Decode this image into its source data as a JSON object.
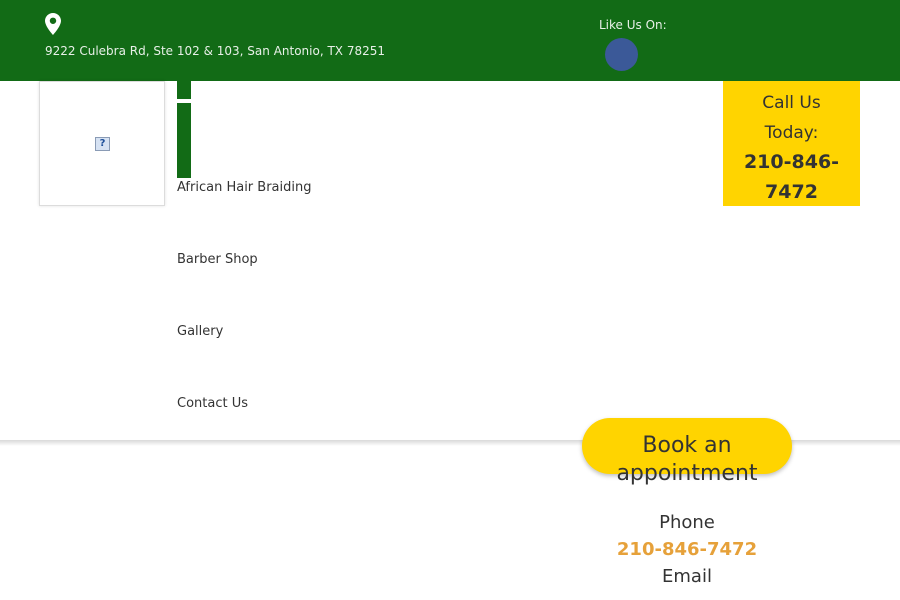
{
  "topbar": {
    "address": "9222 Culebra Rd, Ste 102 & 103, San Antonio, TX 78251",
    "like_label": "Like Us On:",
    "background": "#126b16"
  },
  "icons": {
    "location": "map-pin-icon",
    "social": "facebook-icon",
    "logo": "broken-image-icon"
  },
  "nav": {
    "items": [
      {
        "label": "African Hair Braiding"
      },
      {
        "label": "Barber Shop"
      },
      {
        "label": "Gallery"
      },
      {
        "label": "Contact Us"
      }
    ]
  },
  "call": {
    "label_line1": "Call Us",
    "label_line2": "Today:",
    "phone_line1": "210-846-",
    "phone_line2": "7472",
    "background": "#ffd400"
  },
  "booking": {
    "line1": "Book an",
    "line2": "appointment"
  },
  "contact": {
    "phone_label": "Phone",
    "phone_value": "210-846-7472",
    "email_label": "Email",
    "link_color": "#e6a13a"
  }
}
